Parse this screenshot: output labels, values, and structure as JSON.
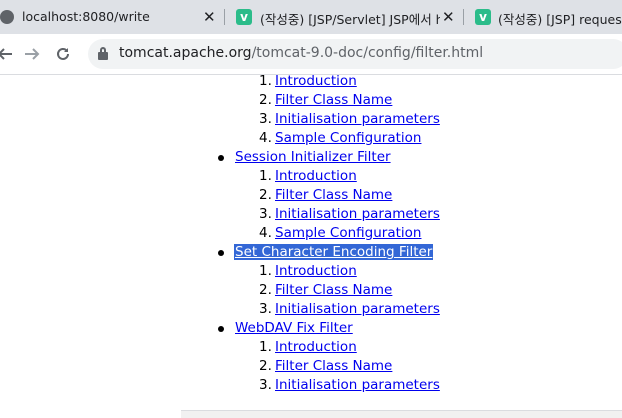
{
  "tabs": [
    {
      "title": "localhost:8080/write",
      "favicon": "globe-icon"
    },
    {
      "title": "(작성중) [JSP/Servlet] JSP에서 h",
      "favicon": "v-icon"
    },
    {
      "title": "(작성중) [JSP] request.g",
      "favicon": "v-icon"
    }
  ],
  "favicon_letter": "v",
  "address_bar": {
    "host": "tomcat.apache.org",
    "path": "/tomcat-9.0-doc/config/filter.html"
  },
  "toc": {
    "first_block": [
      {
        "num": "1.",
        "label": "Introduction"
      },
      {
        "num": "2.",
        "label": "Filter Class Name"
      },
      {
        "num": "3.",
        "label": "Initialisation parameters"
      },
      {
        "num": "4.",
        "label": "Sample Configuration"
      }
    ],
    "sections": [
      {
        "title": "Session Initializer Filter",
        "items": [
          {
            "num": "1.",
            "label": "Introduction"
          },
          {
            "num": "2.",
            "label": "Filter Class Name"
          },
          {
            "num": "3.",
            "label": "Initialisation parameters"
          },
          {
            "num": "4.",
            "label": "Sample Configuration"
          }
        ]
      },
      {
        "title": "Set Character Encoding Filter",
        "selected": true,
        "items": [
          {
            "num": "1.",
            "label": "Introduction"
          },
          {
            "num": "2.",
            "label": "Filter Class Name"
          },
          {
            "num": "3.",
            "label": "Initialisation parameters"
          }
        ]
      },
      {
        "title": "WebDAV Fix Filter",
        "items": [
          {
            "num": "1.",
            "label": "Introduction"
          },
          {
            "num": "2.",
            "label": "Filter Class Name"
          },
          {
            "num": "3.",
            "label": "Initialisation parameters"
          }
        ]
      }
    ]
  }
}
